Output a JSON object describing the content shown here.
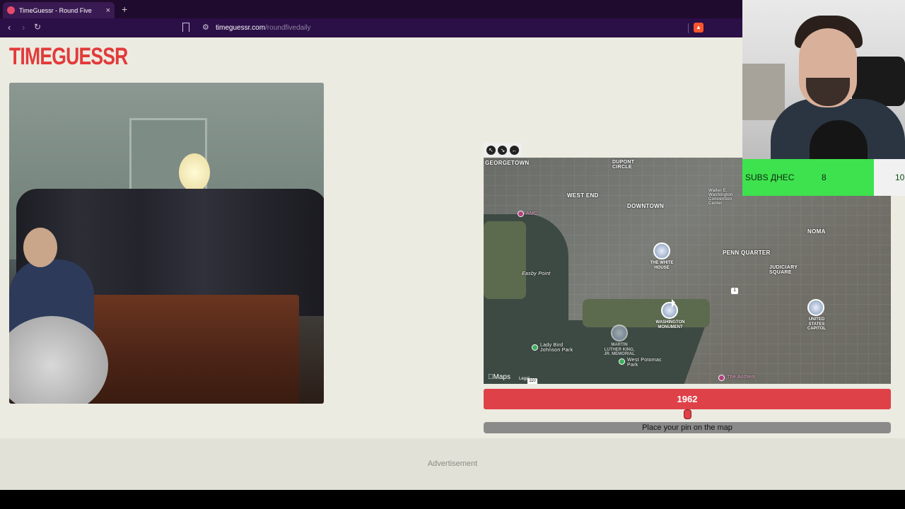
{
  "browser": {
    "tab_title": "TimeGuessr - Round Five",
    "tab_close": "×",
    "new_tab": "+",
    "url_host": "timeguessr.com",
    "url_path": "/roundfivedaily",
    "back": "‹",
    "forward": "›",
    "reload": "↻"
  },
  "site": {
    "logo": "TIMEGUESSR"
  },
  "map": {
    "labels": {
      "georgetown": "GEORGETOWN",
      "dupont": "DUPONT CIRCLE",
      "west_end": "WEST END",
      "downtown": "DOWNTOWN",
      "convention": "Walter E. Washington Convention Center",
      "amc": "AMC",
      "noma": "NOMA",
      "penn_quarter": "PENN QUARTER",
      "judiciary": "JUDICIARY SQUARE",
      "easby": "Easby Point",
      "white_house": "THE WHITE HOUSE",
      "washington_monument": "WASHINGTON MONUMENT",
      "capitol": "UNITED STATES CAPITOL",
      "ladybird": "Lady Bird Johnson Park",
      "west_potomac": "West Potomac Park",
      "mlk": "MARTIN LUTHER KING, JR. MEMORIAL",
      "anthem": "The Anthem",
      "route": "1",
      "route2": "110"
    },
    "brand": "Maps",
    "legal": "Legal"
  },
  "game": {
    "year": "1962",
    "year_fraction": 0.5,
    "pin_prompt": "Place your pin on the map"
  },
  "ad": {
    "label": "Advertisement"
  },
  "overlay": {
    "subs_label": "SUBS ДНЕС",
    "subs_current": "8",
    "subs_goal": "10"
  },
  "icons": {
    "favicon": "timeguessr-favicon-icon",
    "bookmark": "bookmark-icon",
    "brave": "brave-shield-icon"
  },
  "colors": {
    "accent": "#df4148",
    "logo": "#e23a3a",
    "subs_bar": "#3ee24e"
  }
}
